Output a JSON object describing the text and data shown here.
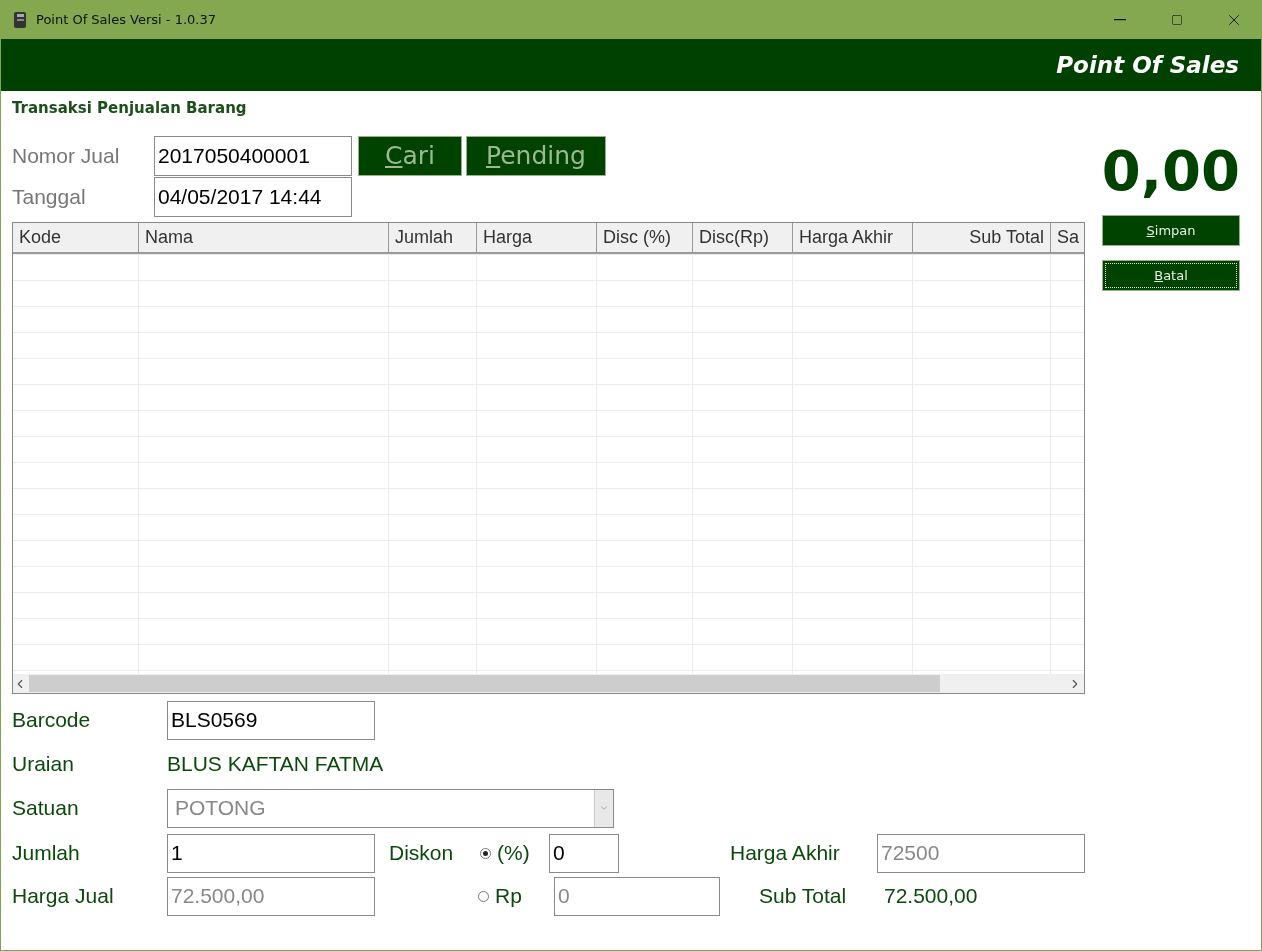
{
  "window": {
    "title": "Point Of Sales Versi - 1.0.37"
  },
  "header": {
    "title": "Point Of Sales"
  },
  "section_title": "Transaksi Penjualan Barang",
  "nomor_jual": {
    "label": "Nomor Jual",
    "value": "2017050400001"
  },
  "tanggal": {
    "label": "Tanggal",
    "value": "04/05/2017 14:44"
  },
  "top_buttons": [
    {
      "label": "Cari",
      "focused": false
    },
    {
      "label": "Pending",
      "focused": false
    }
  ],
  "total": "0,00",
  "side_buttons": [
    {
      "label": "Simpan",
      "focused": false
    },
    {
      "label": "Batal",
      "focused": true
    }
  ],
  "table": {
    "columns": [
      {
        "label": "Kode"
      },
      {
        "label": "Nama"
      },
      {
        "label": "Jumlah"
      },
      {
        "label": "Harga"
      },
      {
        "label": "Disc (%)"
      },
      {
        "label": "Disc(Rp)"
      },
      {
        "label": "Harga Akhir"
      },
      {
        "label": "Sub Total"
      },
      {
        "label": "Sa"
      }
    ]
  },
  "barcode": {
    "label": "Barcode",
    "value": "BLS0569",
    "disabled": false
  },
  "uraian": {
    "label": "Uraian",
    "value": "BLUS KAFTAN FATMA"
  },
  "satuan": {
    "label": "Satuan",
    "value": "POTONG",
    "disabled": true
  },
  "jumlah": {
    "label": "Jumlah",
    "value": "1",
    "disabled": false
  },
  "harga_jual": {
    "label": "Harga Jual",
    "value": "72.500,00",
    "disabled": true
  },
  "diskon": {
    "label": "Diskon",
    "options": [
      {
        "label": "(%)",
        "selected": true,
        "value": "0",
        "disabled": false
      },
      {
        "label": "Rp",
        "selected": false,
        "value": "0",
        "disabled": true
      }
    ]
  },
  "harga_akhir": {
    "label": "Harga Akhir",
    "value": "72500",
    "disabled": true
  },
  "sub_total": {
    "label": "Sub Total",
    "value": "72.500,00"
  }
}
